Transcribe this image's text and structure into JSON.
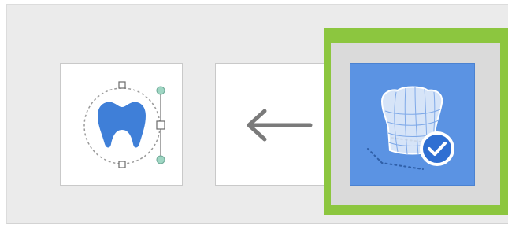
{
  "toolbar": {
    "buttons": [
      {
        "icon": "tooth-transform-icon"
      },
      {
        "icon": "arrow-left-icon"
      },
      {
        "icon": "crown-confirm-icon",
        "selected": true
      }
    ]
  },
  "colors": {
    "highlight": "#8cc63f",
    "selected_button": "#5b93e3",
    "tooth_blue": "#3f7fd8",
    "handle_green": "#9fd6c3"
  }
}
